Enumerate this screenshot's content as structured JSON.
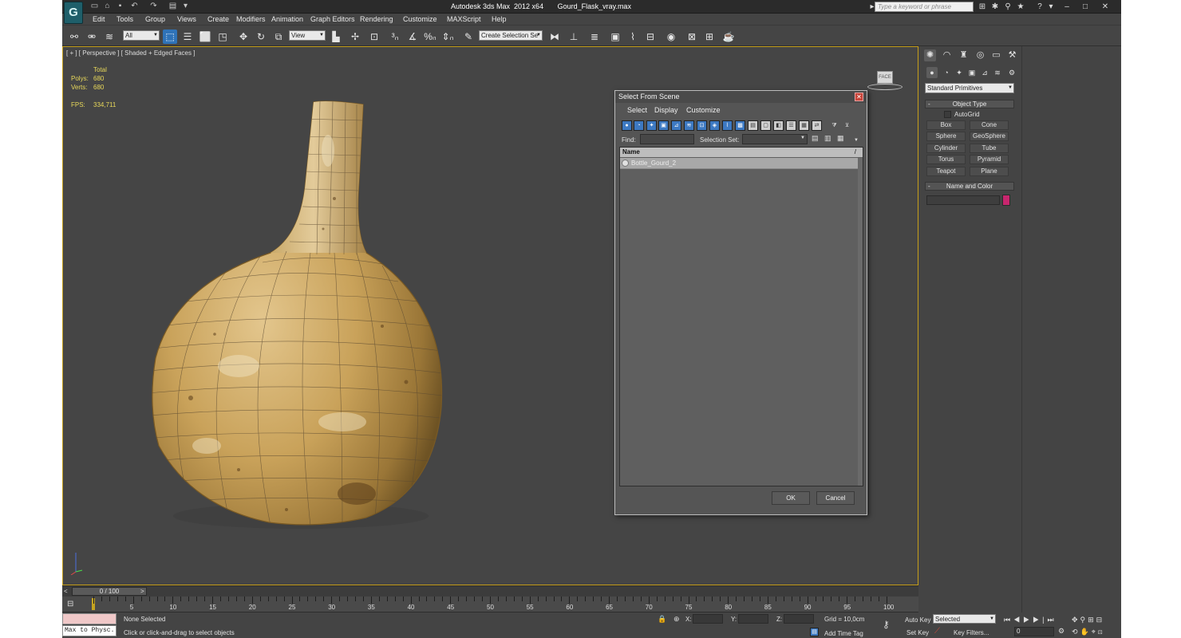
{
  "window": {
    "title": "Autodesk 3ds Max  2012 x64       Gourd_Flask_vray.max",
    "search_placeholder": "Type a keyword or phrase",
    "logo_glyph": "G"
  },
  "menu": {
    "items": [
      "Edit",
      "Tools",
      "Group",
      "Views",
      "Create",
      "Modifiers",
      "Animation",
      "Graph Editors",
      "Rendering",
      "Customize",
      "MAXScript",
      "Help"
    ]
  },
  "toolbar": {
    "filter_value": "All",
    "coord_value": "View",
    "selection_set_value": "Create Selection Se"
  },
  "viewport": {
    "label": "[ + ] [ Perspective ] [ Shaded + Edged Faces ]",
    "stats_header": "Total",
    "polys_label": "Polys:",
    "polys_value": "680",
    "verts_label": "Verts:",
    "verts_value": "680",
    "fps_label": "FPS:",
    "fps_value": "334,711",
    "viewcube_label": "FACE"
  },
  "command_panel": {
    "category_value": "Standard Primitives",
    "object_type_title": "Object Type",
    "autogrid_label": "AutoGrid",
    "buttons": [
      "Box",
      "Cone",
      "Sphere",
      "GeoSphere",
      "Cylinder",
      "Tube",
      "Torus",
      "Pyramid",
      "Teapot",
      "Plane"
    ],
    "name_color_title": "Name and Color",
    "color_swatch": "#c8266e"
  },
  "dialog": {
    "title": "Select From Scene",
    "menu": [
      "Select",
      "Display",
      "Customize"
    ],
    "find_label": "Find:",
    "selection_set_label": "Selection Set:",
    "column_name": "Name",
    "rows": [
      "Bottle_Gourd_2"
    ],
    "ok_label": "OK",
    "cancel_label": "Cancel"
  },
  "timeline": {
    "frame_display": "0 / 100",
    "tick_labels": [
      "0",
      "5",
      "10",
      "15",
      "20",
      "25",
      "30",
      "35",
      "40",
      "45",
      "50",
      "55",
      "60",
      "65",
      "70",
      "75",
      "80",
      "85",
      "90",
      "95",
      "100"
    ]
  },
  "status": {
    "maxscript_label": "Max to Physc.",
    "selection_status": "None Selected",
    "prompt": "Click or click-and-drag to select objects",
    "x_label": "X:",
    "y_label": "Y:",
    "z_label": "Z:",
    "grid_label": "Grid = 10,0cm",
    "add_time_tag": "Add Time Tag",
    "auto_key_label": "Auto Key",
    "auto_key_value": "Selected",
    "set_key_label": "Set Key",
    "key_filters_label": "Key Filters...",
    "current_frame": "0"
  },
  "colors": {
    "viewport_border": "#c59e1a",
    "stats_text": "#e8d85a",
    "active_tool": "#2f73b8"
  }
}
